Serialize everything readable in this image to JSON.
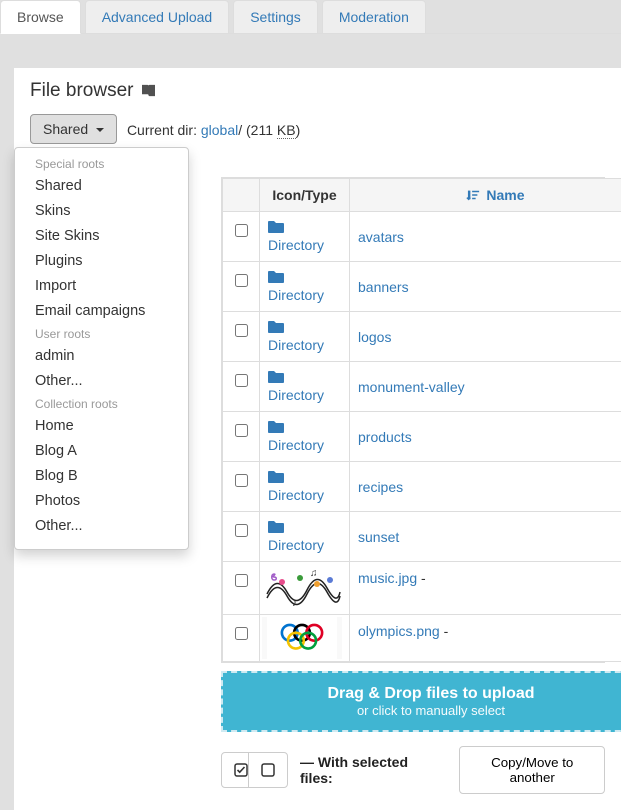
{
  "tabs": {
    "browse": "Browse",
    "upload": "Advanced Upload",
    "settings": "Settings",
    "moderation": "Moderation"
  },
  "header": {
    "title": "File browser"
  },
  "shared_btn": "Shared",
  "curdir": {
    "label": "Current dir:",
    "path": "global",
    "slash": "/",
    "size_prefix": " (211 ",
    "size_abbr": "KB",
    "size_suffix": ")"
  },
  "dropdown": {
    "h1": "Special roots",
    "special": [
      "Shared",
      "Skins",
      "Site Skins",
      "Plugins",
      "Import",
      "Email campaigns"
    ],
    "h2": "User roots",
    "user": [
      "admin",
      "Other..."
    ],
    "h3": "Collection roots",
    "collection": [
      "Home",
      "Blog A",
      "Blog B",
      "Photos",
      "Other..."
    ]
  },
  "table": {
    "col_icon": "Icon/Type",
    "col_name": "Name",
    "dir_label": "Directory",
    "rows": [
      {
        "type": "dir",
        "name": "avatars"
      },
      {
        "type": "dir",
        "name": "banners"
      },
      {
        "type": "dir",
        "name": "logos"
      },
      {
        "type": "dir",
        "name": "monument-valley"
      },
      {
        "type": "dir",
        "name": "products"
      },
      {
        "type": "dir",
        "name": "recipes"
      },
      {
        "type": "dir",
        "name": "sunset"
      },
      {
        "type": "img",
        "name": "music.jpg",
        "suffix": " -",
        "thumb": "music"
      },
      {
        "type": "img",
        "name": "olympics.png",
        "suffix": " -",
        "thumb": "olympics"
      }
    ]
  },
  "dropzone": {
    "title": "Drag & Drop files to upload",
    "sub": "or click to manually select"
  },
  "actions": {
    "with_selected": "— With selected files:",
    "copymove": "Copy/Move to another"
  }
}
